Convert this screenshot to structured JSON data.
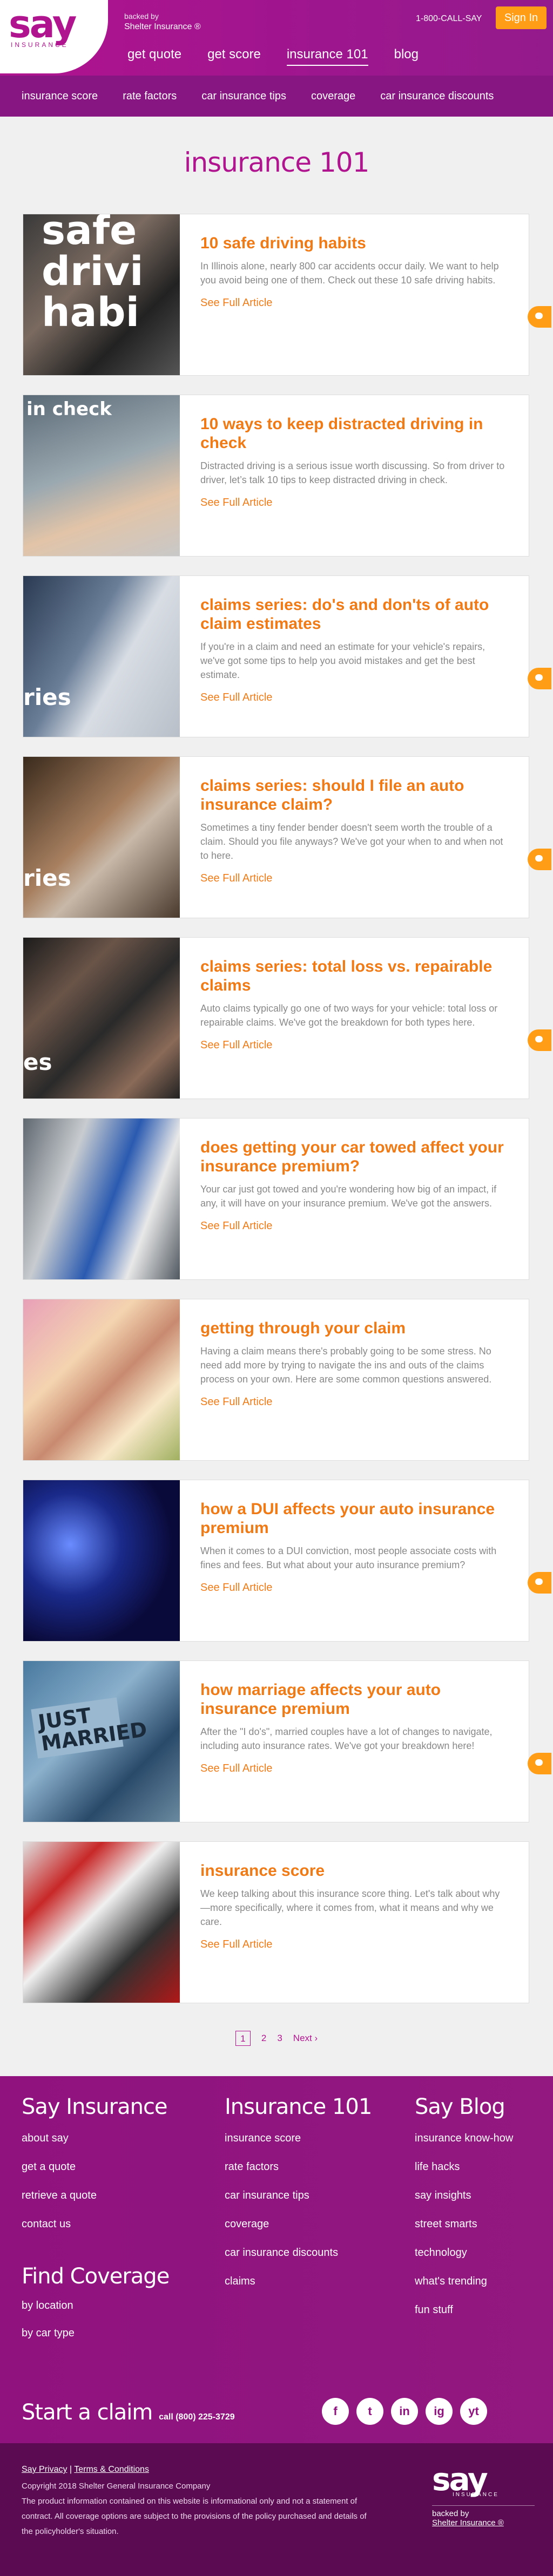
{
  "header": {
    "logo_word": "say",
    "logo_sub": "INSURANCE",
    "backed_by": "backed by",
    "backer": "Shelter Insurance ®",
    "phone": "1-800-CALL-SAY",
    "signin": "Sign In",
    "nav": [
      "get quote",
      "get score",
      "insurance 101",
      "blog"
    ]
  },
  "subnav": [
    "insurance score",
    "rate factors",
    "car insurance tips",
    "coverage",
    "car insurance discounts"
  ],
  "page_title": "insurance 101",
  "see_full": "See Full Article",
  "articles": [
    {
      "title": "10 safe driving habits",
      "desc": "In Illinois alone, nearly 800 car accidents occur daily. We want to help you avoid being one of them. Check out these 10 safe driving habits.",
      "thumb_label": "safe drivi habi"
    },
    {
      "title": "10 ways to keep distracted driving in check",
      "desc": "Distracted driving is a serious issue worth discussing. So from driver to driver, let’s talk 10 tips to keep distracted driving in check.",
      "thumb_label": "in check"
    },
    {
      "title": "claims series: do's and don'ts of auto claim estimates",
      "desc": "If you're in a claim and need an estimate for your vehicle's repairs, we've got some tips to help you avoid mistakes and get the best estimate.",
      "thumb_label": "ries"
    },
    {
      "title": "claims series: should I file an auto insurance claim?",
      "desc": "Sometimes a tiny fender bender doesn't seem worth the trouble of a claim. Should you file anyways? We've got your when to and when not to here.",
      "thumb_label": "ries"
    },
    {
      "title": "claims series: total loss vs. repairable claims",
      "desc": "Auto claims typically go one of two ways for your vehicle: total loss or repairable claims. We've got the breakdown for both types here.",
      "thumb_label": "es"
    },
    {
      "title": "does getting your car towed affect your insurance premium?",
      "desc": "Your car just got towed and you're wondering how big of an impact, if any, it will have on your insurance premium. We've got the answers.",
      "thumb_label": ""
    },
    {
      "title": "getting through your claim",
      "desc": "Having a claim means there's probably going to be some stress. No need add more by trying to navigate the ins and outs of the claims process on your own. Here are some common questions answered.",
      "thumb_label": ""
    },
    {
      "title": "how a DUI affects your auto insurance premium",
      "desc": "When it comes to a DUI conviction, most people associate costs with fines and fees. But what about your auto insurance premium?",
      "thumb_label": ""
    },
    {
      "title": "how marriage affects your auto insurance premium",
      "desc": "After the \"I do's\", married couples have a lot of changes to navigate, including auto insurance rates. We've got your breakdown here!",
      "thumb_label": "JUST MARRIED"
    },
    {
      "title": "insurance score",
      "desc": "We keep talking about this insurance score thing. Let's talk about why—more specifically, where it comes from, what it means and why we care.",
      "thumb_label": ""
    }
  ],
  "pager": {
    "pages": [
      "1",
      "2",
      "3"
    ],
    "next": "Next ›"
  },
  "footer": {
    "col1": {
      "title": "Say Insurance",
      "links": [
        "about say",
        "get a quote",
        "retrieve a quote",
        "contact us"
      ]
    },
    "col2": {
      "title": "Insurance 101",
      "links": [
        "insurance score",
        "rate factors",
        "car insurance tips",
        "coverage",
        "car insurance discounts",
        "claims"
      ]
    },
    "col3": {
      "title": "Say Blog",
      "links": [
        "insurance know-how",
        "life hacks",
        "say insights",
        "street smarts",
        "technology",
        "what's trending",
        "fun stuff"
      ]
    },
    "find": {
      "title": "Find Coverage",
      "links": [
        "by location",
        "by car type"
      ]
    },
    "claim": "Start a claim",
    "claim_phone": "call (800) 225-3729",
    "socials": [
      "f",
      "t",
      "in",
      "ig",
      "yt"
    ]
  },
  "legal": {
    "privacy": "Say Privacy",
    "sep": "|",
    "terms": "Terms & Conditions",
    "copyright": "Copyright 2018 Shelter General Insurance Company",
    "disclaimer": "The product information contained on this website is informational only and not a statement of contract. All coverage options are subject to the provisions of the policy purchased and details of the policyholder's situation.",
    "logo_word": "say",
    "logo_sub": "INSURANCE",
    "backed_by": "backed by",
    "backer": "Shelter Insurance ®"
  }
}
